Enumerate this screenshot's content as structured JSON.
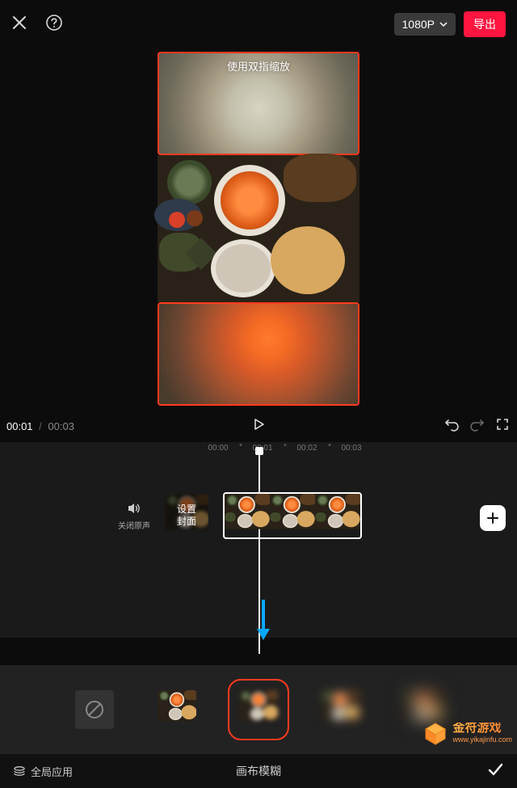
{
  "topbar": {
    "resolution": "1080P",
    "export": "导出"
  },
  "preview": {
    "hint": "使用双指缩放"
  },
  "time": {
    "current": "00:01",
    "separator": "/",
    "duration": "00:03"
  },
  "ruler": {
    "t0": "00:00",
    "t1": "00:01",
    "t2": "00:02",
    "t3": "00:03"
  },
  "tracks": {
    "mute_label": "关闭原声",
    "cover_label": "设置\n封面"
  },
  "panel": {
    "title": "画布模糊",
    "global": "全局应用"
  },
  "watermark": {
    "brand": "金符游戏",
    "url": "www.yikajinfu.com"
  }
}
